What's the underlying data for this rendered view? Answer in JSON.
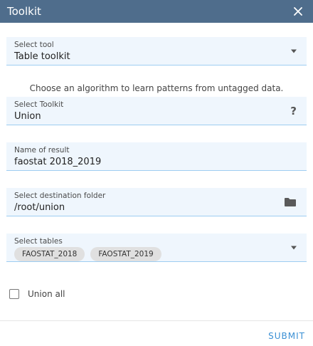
{
  "dialog": {
    "title": "Toolkit",
    "close_icon": "close-icon"
  },
  "select_tool": {
    "label": "Select tool",
    "value": "Table toolkit",
    "icon": "caret-down-icon"
  },
  "hint": "Choose an algorithm to learn patterns from untagged data.",
  "select_toolkit": {
    "label": "Select Toolkit",
    "value": "Union",
    "help_symbol": "?"
  },
  "name_of_result": {
    "label": "Name of result",
    "value": "faostat 2018_2019"
  },
  "destination_folder": {
    "label": "Select destination folder",
    "value": "/root/union",
    "icon": "folder-icon"
  },
  "select_tables": {
    "label": "Select tables",
    "chips": [
      "FAOSTAT_2018",
      "FAOSTAT_2019"
    ],
    "icon": "caret-down-icon"
  },
  "union_all": {
    "label": "Union all",
    "checked": false
  },
  "footer": {
    "submit_label": "SUBMIT"
  },
  "colors": {
    "titlebar": "#4f6d8c",
    "field_bg": "#eff6fd",
    "field_underline": "#9ecdf1",
    "accent": "#3a8fd4"
  }
}
